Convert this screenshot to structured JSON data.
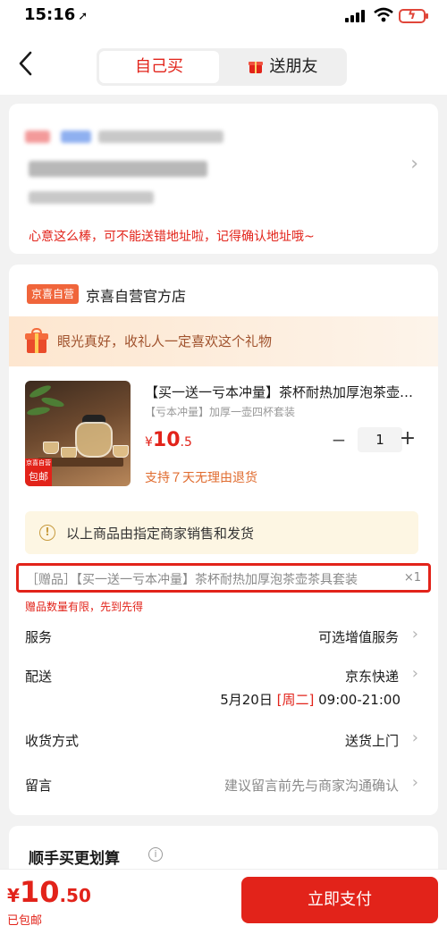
{
  "status_bar": {
    "time": "15:16"
  },
  "nav": {
    "tabs": [
      {
        "label": "自己买"
      },
      {
        "label": "送朋友"
      }
    ]
  },
  "address": {
    "note": "心意这么棒，可不能送错地址啦，记得确认地址哦~"
  },
  "shop": {
    "badge": "京喜自营",
    "name": "京喜自营官方店"
  },
  "gift_banner": "眼光真好，收礼人一定喜欢这个礼物",
  "product": {
    "title": "【买一送一亏本冲量】茶杯耐热加厚泡茶壶茶具套装",
    "spec": "【亏本冲量】加厚一壶四杯套装",
    "price_symbol": "¥",
    "price_int": "10",
    "price_dec": ".5",
    "quantity": "1",
    "return_policy": "支持７天无理由退货",
    "image_tag_top": "京喜自营",
    "image_tag_bottom": "包邮"
  },
  "seller_notice": "以上商品由指定商家销售和发货",
  "gift_item": {
    "text": "［赠品］【买一送一亏本冲量】茶杯耐热加厚泡茶壶茶具套装",
    "qty": "×1"
  },
  "gift_limit": "赠品数量有限，先到先得",
  "rows": {
    "service": {
      "label": "服务",
      "value": "可选增值服务"
    },
    "delivery": {
      "label": "配送",
      "value": "京东快递",
      "date": "5月20日",
      "weekday": "[周二]",
      "window": "09:00-21:00"
    },
    "receive": {
      "label": "收货方式",
      "value": "送货上门"
    },
    "message": {
      "label": "留言",
      "value": "建议留言前先与商家沟通确认"
    }
  },
  "bottom_section": {
    "title": "顺手买更划算"
  },
  "footer": {
    "price_symbol": "¥",
    "price_int": "10",
    "price_dec": ".50",
    "shipping": "已包邮",
    "pay_label": "立即支付"
  },
  "colors": {
    "accent": "#e2231a",
    "orange": "#f0653b",
    "warn_bg": "#fdf6e3"
  }
}
